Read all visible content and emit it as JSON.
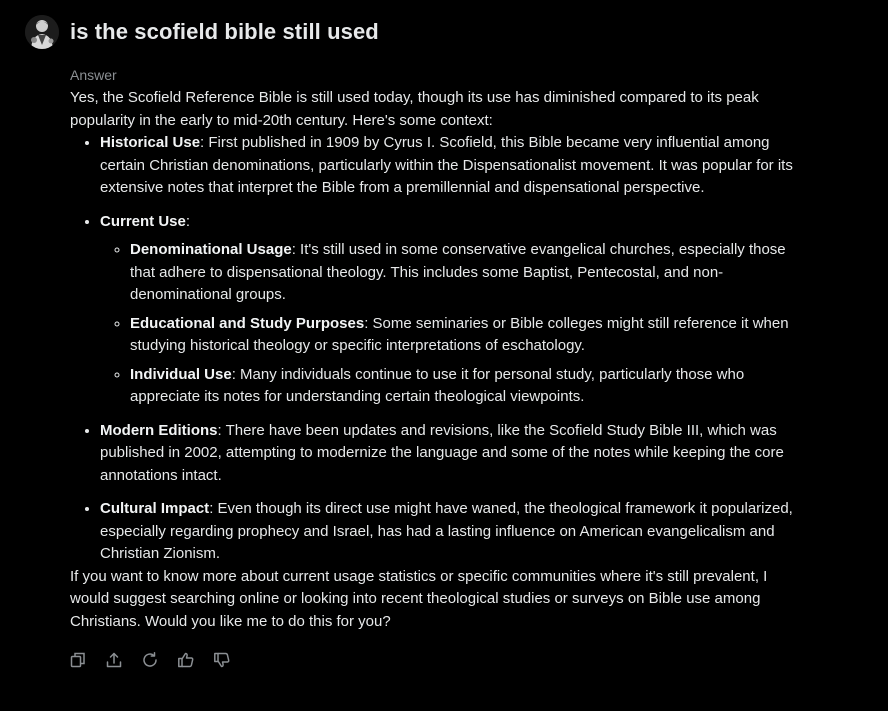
{
  "header": {
    "title": "is the scofield bible still used",
    "avatar_icon": "user-avatar"
  },
  "answer": {
    "label": "Answer",
    "intro": "Yes, the Scofield Reference Bible is still used today, though its use has diminished compared to its peak popularity in the early to mid-20th century. Here's some context:",
    "points": [
      {
        "title": "Historical Use",
        "text": ": First published in 1909 by Cyrus I. Scofield, this Bible became very influential among certain Christian denominations, particularly within the Dispensationalist movement. It was popular for its extensive notes that interpret the Bible from a premillennial and dispensational perspective."
      },
      {
        "title": "Current Use",
        "text": ":",
        "subpoints": [
          {
            "title": "Denominational Usage",
            "text": ": It's still used in some conservative evangelical churches, especially those that adhere to dispensational theology. This includes some Baptist, Pentecostal, and non-denominational groups."
          },
          {
            "title": "Educational and Study Purposes",
            "text": ": Some seminaries or Bible colleges might still reference it when studying historical theology or specific interpretations of eschatology."
          },
          {
            "title": "Individual Use",
            "text": ": Many individuals continue to use it for personal study, particularly those who appreciate its notes for understanding certain theological viewpoints."
          }
        ]
      },
      {
        "title": "Modern Editions",
        "text": ": There have been updates and revisions, like the Scofield Study Bible III, which was published in 2002, attempting to modernize the language and some of the notes while keeping the core annotations intact."
      },
      {
        "title": "Cultural Impact",
        "text": ": Even though its direct use might have waned, the theological framework it popularized, especially regarding prophecy and Israel, has had a lasting influence on American evangelicalism and Christian Zionism."
      }
    ],
    "outro": "If you want to know more about current usage statistics or specific communities where it's still prevalent, I would suggest searching online or looking into recent theological studies or surveys on Bible use among Christians. Would you like me to do this for you?"
  },
  "actions": [
    {
      "name": "copy-button",
      "icon": "copy-icon"
    },
    {
      "name": "share-button",
      "icon": "share-icon"
    },
    {
      "name": "regenerate-button",
      "icon": "refresh-icon"
    },
    {
      "name": "like-button",
      "icon": "thumbs-up-icon"
    },
    {
      "name": "dislike-button",
      "icon": "thumbs-down-icon"
    }
  ],
  "colors": {
    "background": "#000000",
    "text": "#e7e9ea",
    "muted": "#8b8f93",
    "icon": "#8b8f93"
  }
}
